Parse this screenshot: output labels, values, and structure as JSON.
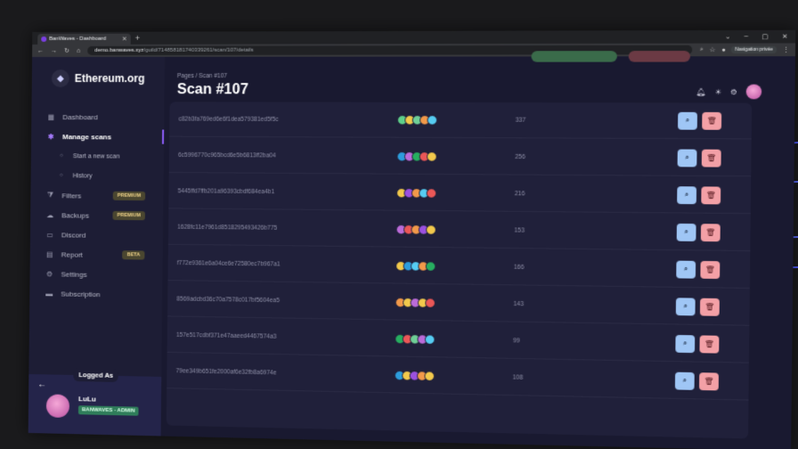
{
  "browser": {
    "tab_title": "BanWaves - Dashboard",
    "url_host": "demo.banwaves.xyz",
    "url_path": "/guild/714858181740339261/scan/107/details",
    "private_label": "Navigation privée"
  },
  "sidebar": {
    "server_name": "Ethereum.org",
    "items": [
      {
        "label": "Dashboard",
        "icon": "grid-icon"
      },
      {
        "label": "Manage scans",
        "icon": "running-icon"
      },
      {
        "label": "Start a new scan",
        "icon": "dot-icon"
      },
      {
        "label": "History",
        "icon": "dot-icon"
      },
      {
        "label": "Filters",
        "icon": "filter-icon",
        "badge": "PREMIUM"
      },
      {
        "label": "Backups",
        "icon": "cloud-icon",
        "badge": "PREMIUM"
      },
      {
        "label": "Discord",
        "icon": "monitor-icon"
      },
      {
        "label": "Report",
        "icon": "clipboard-icon",
        "badge": "BETA"
      },
      {
        "label": "Settings",
        "icon": "gear-icon"
      },
      {
        "label": "Subscription",
        "icon": "card-icon"
      }
    ],
    "logged": {
      "label": "Logged As",
      "name": "LuLu",
      "role": "BANWAVES - ADMIN"
    }
  },
  "header": {
    "breadcrumb_root": "Pages",
    "breadcrumb_current": "Scan #107",
    "title": "Scan #107"
  },
  "rows": [
    {
      "hash": "c82b3fa769ed6e6f1dea579381ed5f5c",
      "count": "337",
      "colors": [
        "#5fd08a",
        "#f2c94c",
        "#6fcf97",
        "#f2994a",
        "#56ccf2"
      ]
    },
    {
      "hash": "6c5996770c965bcd6e5b6813ff2ba04",
      "count": "256",
      "colors": [
        "#2d9cdb",
        "#bb6bd9",
        "#27ae60",
        "#eb5757",
        "#f2c94c"
      ]
    },
    {
      "hash": "5445ffd7ffb201a96393cbdf684ea4b1",
      "count": "216",
      "colors": [
        "#f2c94c",
        "#9b51e0",
        "#f2994a",
        "#56ccf2",
        "#eb5757"
      ]
    },
    {
      "hash": "1628fc11e7961d8518295493426b775",
      "count": "153",
      "colors": [
        "#bb6bd9",
        "#eb5757",
        "#f2994a",
        "#9b51e0",
        "#f2c94c"
      ]
    },
    {
      "hash": "f772e9361e6a04ce6e72580ec7b967a1",
      "count": "166",
      "colors": [
        "#f2c94c",
        "#2d9cdb",
        "#56ccf2",
        "#f2994a",
        "#27ae60"
      ]
    },
    {
      "hash": "8569adcbd36c70a7578c017bf5604ea5",
      "count": "143",
      "colors": [
        "#f2994a",
        "#f2c94c",
        "#bb6bd9",
        "#f2c94c",
        "#eb5757"
      ]
    },
    {
      "hash": "157e517cdbf371e47aaeed4467574a3",
      "count": "99",
      "colors": [
        "#27ae60",
        "#eb5757",
        "#6fcf97",
        "#bb6bd9",
        "#56ccf2"
      ]
    },
    {
      "hash": "79ee349b651fe2000af6e32fb8a6974e",
      "count": "108",
      "colors": [
        "#2d9cdb",
        "#f2c94c",
        "#9b51e0",
        "#f2994a",
        "#f2c94c"
      ]
    }
  ]
}
